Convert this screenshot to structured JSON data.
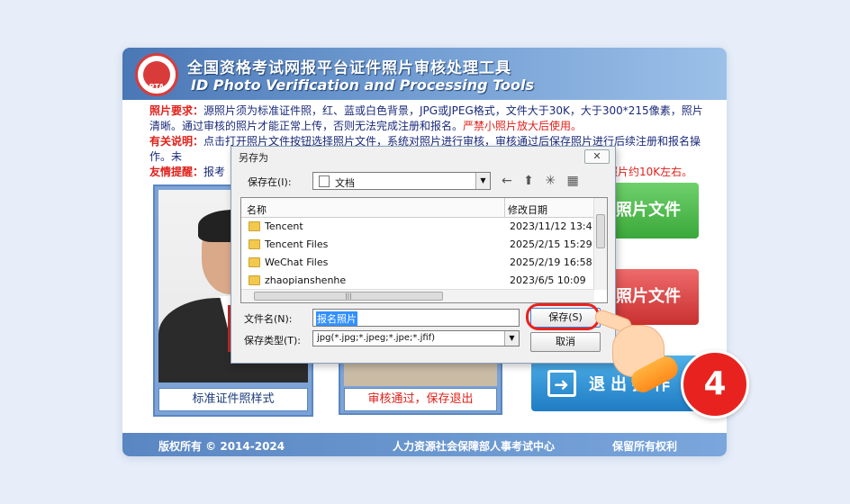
{
  "app": {
    "title_cn": "全国资格考试网报平台证件照片审核处理工具",
    "title_en": "ID Photo Verification and Processing Tools",
    "logo_text": "PTA"
  },
  "notice": {
    "line1_label": "照片要求：",
    "line1_text": "源照片须为标准证件照，红、蓝或白色背景，JPG或JPEG格式，文件大于30K，大于300*215像素，照片清晰。通过审核的照片才能正常上传，否则无法完成注册和报名。",
    "line1_red": "严禁小照片放大后使用。",
    "line2_label": "有关说明：",
    "line2_text": "点击打开照片文件按钮选择照片文件，系统对照片进行审核，审核通过后保存照片进行后续注册和报名操作。未",
    "line2_tail": "照片约10K左右。",
    "line3_label": "友情提醒：",
    "line3_text": "报考"
  },
  "sample": {
    "label": "标准证件照样式"
  },
  "result": {
    "label": "审核通过，保存退出"
  },
  "buttons": {
    "open_photo": "照片文件",
    "save_photo": "照片文件",
    "exit": "退出操作"
  },
  "footer": {
    "left": "版权所有 © 2014-2024",
    "middle": "人力资源社会保障部人事考试中心",
    "right": "保留所有权利"
  },
  "dialog": {
    "title": "另存为",
    "close": "✕",
    "save_in_label": "保存在(I):",
    "save_in_value": "文档",
    "toolbar_icons": "← ⬆ ✳ ▦",
    "col_name": "名称",
    "col_date": "修改日期",
    "rows": [
      {
        "name": "Tencent",
        "date": "2023/11/12 13:4"
      },
      {
        "name": "Tencent Files",
        "date": "2025/2/15 15:29"
      },
      {
        "name": "WeChat Files",
        "date": "2025/2/19 16:58"
      },
      {
        "name": "zhaopianshenhe",
        "date": "2023/6/5 10:09"
      }
    ],
    "file_name_label": "文件名(N):",
    "file_name_value": "报名照片",
    "file_type_label": "保存类型(T):",
    "file_type_value": "jpg(*.jpg;*.jpeg;*.jpe;*.jfif)",
    "save_button": "保存(S)",
    "cancel_button": "取消"
  },
  "step_number": "4",
  "colors": {
    "accent_blue": "#5a86c2",
    "highlight_red": "#e8231f",
    "green_button": "#3aa83a",
    "red_button": "#c93030",
    "exit_button": "#1f7cc4"
  }
}
